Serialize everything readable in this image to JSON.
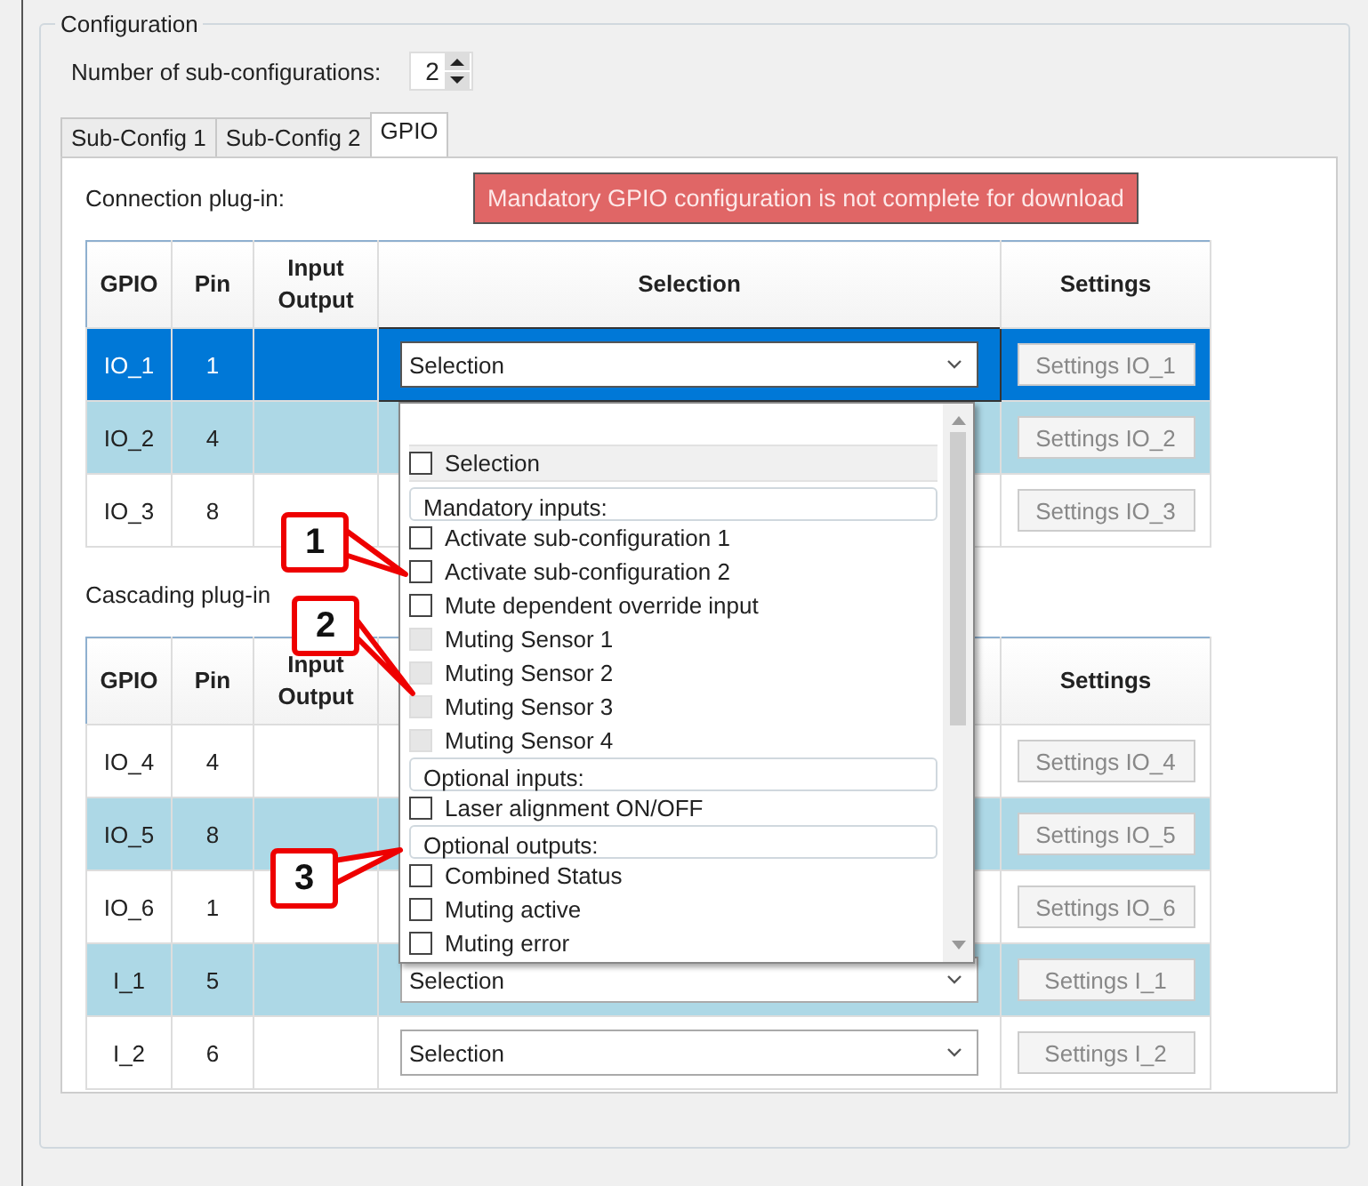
{
  "group_title": "Configuration",
  "sub_configs": {
    "label": "Number of sub-configurations:",
    "value": "2"
  },
  "tabs": [
    {
      "label": "Sub-Config 1",
      "selected": false
    },
    {
      "label": "Sub-Config 2",
      "selected": false
    },
    {
      "label": "GPIO",
      "selected": true
    }
  ],
  "tables": [
    {
      "title": "Connection plug-in:",
      "warning": "Mandatory GPIO configuration is not complete for download",
      "columns": [
        "GPIO",
        "Pin",
        "Input Output",
        "Selection",
        "Settings"
      ],
      "rows": [
        {
          "gpio": "IO_1",
          "pin": "1",
          "selection": "Selection",
          "open": true,
          "selected": true,
          "settings": "Settings IO_1"
        },
        {
          "gpio": "IO_2",
          "pin": "4",
          "selected": false,
          "highlighted": true,
          "settings": "Settings IO_2"
        },
        {
          "gpio": "IO_3",
          "pin": "8",
          "selected": false,
          "highlighted": false,
          "settings": "Settings IO_3"
        }
      ]
    },
    {
      "title": "Cascading plug-in",
      "columns": [
        "GPIO",
        "Pin",
        "Input Output",
        "Settings"
      ],
      "rows": [
        {
          "gpio": "IO_4",
          "pin": "4",
          "selected": false,
          "highlighted": false,
          "settings": "Settings IO_4"
        },
        {
          "gpio": "IO_5",
          "pin": "8",
          "selected": false,
          "highlighted": true,
          "settings": "Settings IO_5"
        },
        {
          "gpio": "IO_6",
          "pin": "1",
          "selected": false,
          "highlighted": false,
          "settings": "Settings IO_6"
        },
        {
          "gpio": "I_1",
          "pin": "5",
          "selection": "Selection",
          "selected": false,
          "highlighted": true,
          "settings": "Settings I_1"
        },
        {
          "gpio": "I_2",
          "pin": "6",
          "selection": "Selection",
          "selected": false,
          "highlighted": false,
          "settings": "Settings I_2"
        }
      ]
    }
  ],
  "dropdown": {
    "items": [
      {
        "kind": "header",
        "label": "Selection",
        "checked": false
      },
      {
        "kind": "group",
        "label": "Mandatory inputs:"
      },
      {
        "kind": "option",
        "label": "Activate sub-configuration 1",
        "checked": false,
        "disabled": false
      },
      {
        "kind": "option",
        "label": "Activate sub-configuration 2",
        "checked": false,
        "disabled": false
      },
      {
        "kind": "option",
        "label": "Mute dependent override input",
        "checked": false,
        "disabled": false
      },
      {
        "kind": "option",
        "label": "Muting Sensor 1",
        "checked": false,
        "disabled": true
      },
      {
        "kind": "option",
        "label": "Muting Sensor 2",
        "checked": false,
        "disabled": true
      },
      {
        "kind": "option",
        "label": "Muting Sensor 3",
        "checked": false,
        "disabled": true
      },
      {
        "kind": "option",
        "label": "Muting Sensor 4",
        "checked": false,
        "disabled": true
      },
      {
        "kind": "group",
        "label": "Optional inputs:"
      },
      {
        "kind": "option",
        "label": "Laser alignment ON/OFF",
        "checked": false,
        "disabled": false
      },
      {
        "kind": "group",
        "label": "Optional outputs:"
      },
      {
        "kind": "option",
        "label": "Combined Status",
        "checked": false,
        "disabled": false
      },
      {
        "kind": "option",
        "label": "Muting active",
        "checked": false,
        "disabled": false
      },
      {
        "kind": "option",
        "label": "Muting error",
        "checked": false,
        "disabled": false
      }
    ]
  },
  "callouts": [
    {
      "number": "1"
    },
    {
      "number": "2"
    },
    {
      "number": "3"
    }
  ]
}
